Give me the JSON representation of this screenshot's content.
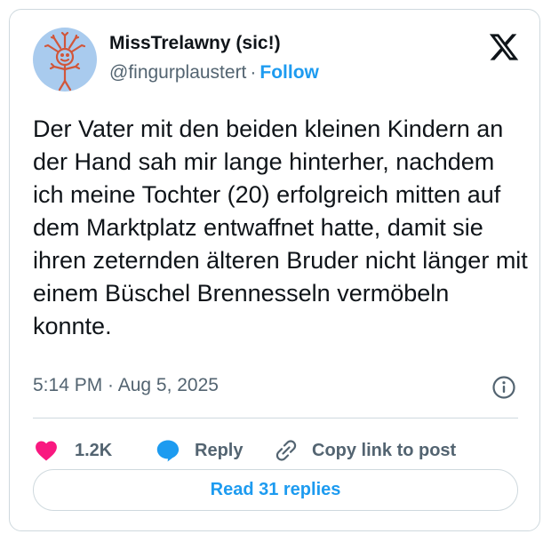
{
  "author": {
    "display_name": "MissTrelawny (sic!)",
    "handle": "@fingurplaustert",
    "separator": "·",
    "follow_label": "Follow"
  },
  "post": {
    "text": "Der Vater mit den beiden kleinen Kindern an der Hand sah mir lange hinterher, nachdem ich meine Tochter (20) erfolgreich mitten auf dem Marktplatz entwaffnet hatte, damit sie ihren zeternden älteren Bruder nicht länger mit einem Büschel Brennesseln vermöbeln konnte.",
    "timestamp": "5:14 PM · Aug 5, 2025"
  },
  "actions": {
    "like_count": "1.2K",
    "reply_label": "Reply",
    "copy_label": "Copy link to post"
  },
  "read_replies_label": "Read 31 replies",
  "icons": {
    "brand": "x-logo-icon",
    "info": "info-icon",
    "like": "heart-icon",
    "reply": "speech-bubble-icon",
    "copy": "link-icon"
  },
  "colors": {
    "accent": "#1d9bf0",
    "like": "#f91880",
    "text": "#0f1419",
    "muted": "#536471",
    "border": "#cfd9de",
    "avatar_bg": "#a9cbee"
  }
}
